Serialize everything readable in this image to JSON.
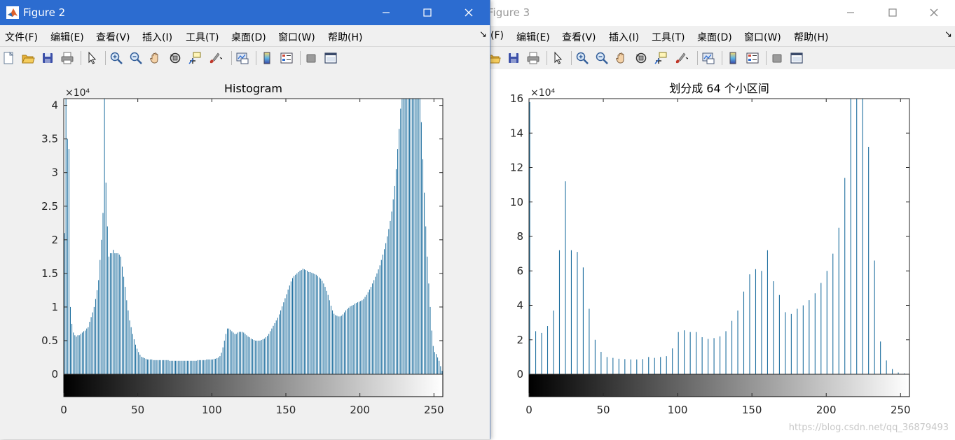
{
  "figure2": {
    "window": {
      "title": "Figure 2",
      "focused": true
    },
    "menu": [
      "文件(F)",
      "编辑(E)",
      "查看(V)",
      "插入(I)",
      "工具(T)",
      "桌面(D)",
      "窗口(W)",
      "帮助(H)"
    ],
    "menu_overflow": "↘",
    "toolbar": [
      "new-figure-icon",
      "open-file-icon",
      "save-icon",
      "print-icon",
      "|",
      "pointer-icon",
      "|",
      "zoom-in-icon",
      "zoom-out-icon",
      "pan-hand-icon",
      "rotate-3d-icon",
      "data-cursor-icon",
      "brush-icon",
      "|",
      "link-plot-icon",
      "|",
      "colorbar-icon",
      "legend-icon",
      "|",
      "hide-plot-tools-icon",
      "show-plot-tools-icon"
    ]
  },
  "figure3": {
    "window": {
      "title": "Figure 3",
      "focused": false
    },
    "menu": [
      "(F)",
      "编辑(E)",
      "查看(V)",
      "插入(I)",
      "工具(T)",
      "桌面(D)",
      "窗口(W)",
      "帮助(H)"
    ],
    "menu_overflow": "↘",
    "toolbar": [
      "open-file-icon",
      "save-icon",
      "print-icon",
      "|",
      "pointer-icon",
      "|",
      "zoom-in-icon",
      "zoom-out-icon",
      "pan-hand-icon",
      "rotate-3d-icon",
      "data-cursor-icon",
      "brush-icon",
      "|",
      "link-plot-icon",
      "|",
      "colorbar-icon",
      "legend-icon",
      "|",
      "hide-plot-tools-icon",
      "show-plot-tools-icon"
    ]
  },
  "watermark": "https://blog.csdn.net/qq_36879493",
  "colors": {
    "bar": "#1f6f9f",
    "titlebar_active": "#2c6cd0"
  },
  "chart_data": [
    {
      "type": "bar",
      "title": "Histogram",
      "exponent_label": "×10⁴",
      "bins": 256,
      "x": "0..255",
      "xlim": [
        0,
        256
      ],
      "ylim": [
        0,
        4.1
      ],
      "xticks": [
        0,
        50,
        100,
        150,
        200,
        250
      ],
      "yticks": [
        0,
        0.5,
        1,
        1.5,
        2,
        2.5,
        3,
        3.5,
        4
      ],
      "ytick_labels": [
        "0",
        "0.5",
        "1",
        "1.5",
        "2",
        "2.5",
        "3",
        "3.5",
        "4"
      ],
      "xtick_labels": [
        "0",
        "50",
        "100",
        "150",
        "200",
        "250"
      ],
      "grayscale_colorbar": true,
      "values": [
        2.1,
        4.1,
        3.5,
        3.35,
        1.0,
        0.75,
        0.62,
        0.58,
        0.56,
        0.58,
        0.58,
        0.6,
        0.62,
        0.64,
        0.65,
        0.68,
        0.7,
        0.78,
        0.85,
        0.92,
        1.0,
        1.12,
        1.25,
        1.4,
        1.7,
        2.0,
        2.4,
        4.1,
        2.85,
        2.2,
        1.75,
        1.8,
        1.8,
        1.85,
        1.8,
        1.8,
        1.8,
        1.78,
        1.75,
        1.6,
        1.45,
        1.3,
        1.1,
        0.95,
        0.8,
        0.7,
        0.6,
        0.52,
        0.44,
        0.38,
        0.33,
        0.29,
        0.26,
        0.25,
        0.24,
        0.23,
        0.22,
        0.22,
        0.22,
        0.22,
        0.21,
        0.21,
        0.21,
        0.21,
        0.21,
        0.21,
        0.21,
        0.21,
        0.21,
        0.21,
        0.21,
        0.2,
        0.2,
        0.2,
        0.2,
        0.2,
        0.2,
        0.2,
        0.2,
        0.2,
        0.2,
        0.2,
        0.2,
        0.2,
        0.2,
        0.2,
        0.2,
        0.2,
        0.2,
        0.2,
        0.21,
        0.21,
        0.21,
        0.21,
        0.21,
        0.21,
        0.22,
        0.22,
        0.22,
        0.22,
        0.22,
        0.23,
        0.23,
        0.24,
        0.25,
        0.27,
        0.32,
        0.4,
        0.5,
        0.6,
        0.68,
        0.68,
        0.66,
        0.64,
        0.62,
        0.6,
        0.6,
        0.62,
        0.63,
        0.63,
        0.63,
        0.62,
        0.6,
        0.58,
        0.56,
        0.55,
        0.53,
        0.52,
        0.51,
        0.5,
        0.5,
        0.5,
        0.5,
        0.51,
        0.52,
        0.53,
        0.55,
        0.57,
        0.6,
        0.64,
        0.68,
        0.72,
        0.76,
        0.8,
        0.84,
        0.89,
        0.95,
        1.01,
        1.07,
        1.13,
        1.19,
        1.26,
        1.32,
        1.38,
        1.43,
        1.46,
        1.48,
        1.5,
        1.52,
        1.54,
        1.55,
        1.57,
        1.56,
        1.55,
        1.54,
        1.52,
        1.52,
        1.51,
        1.5,
        1.49,
        1.48,
        1.46,
        1.44,
        1.42,
        1.39,
        1.35,
        1.3,
        1.24,
        1.18,
        1.1,
        1.02,
        0.95,
        0.9,
        0.88,
        0.87,
        0.86,
        0.86,
        0.87,
        0.89,
        0.92,
        0.95,
        0.97,
        0.99,
        1.01,
        1.02,
        1.03,
        1.05,
        1.06,
        1.07,
        1.08,
        1.09,
        1.1,
        1.12,
        1.15,
        1.18,
        1.22,
        1.26,
        1.3,
        1.35,
        1.4,
        1.45,
        1.5,
        1.56,
        1.62,
        1.7,
        1.78,
        1.86,
        1.95,
        2.05,
        2.16,
        2.28,
        2.42,
        2.6,
        2.8,
        3.05,
        3.35,
        3.65,
        3.95,
        4.1,
        4.1,
        4.1,
        4.1,
        4.1,
        4.1,
        4.1,
        4.1,
        4.1,
        4.1,
        4.1,
        4.1,
        4.1,
        3.75,
        3.2,
        2.7,
        2.2,
        1.75,
        1.35,
        1.0,
        0.65,
        0.42,
        0.33,
        0.3,
        0.25,
        0.2,
        0.12,
        0.05
      ]
    },
    {
      "type": "bar",
      "title": "划分成 64 个小区间",
      "exponent_label": "×10⁴",
      "bins": 64,
      "x": "0,4,8,...,252",
      "xlim": [
        0,
        256
      ],
      "ylim": [
        0,
        16
      ],
      "xticks": [
        0,
        50,
        100,
        150,
        200,
        250
      ],
      "yticks": [
        0,
        2,
        4,
        6,
        8,
        10,
        12,
        14,
        16
      ],
      "ytick_labels": [
        "0",
        "2",
        "4",
        "6",
        "8",
        "10",
        "12",
        "14",
        "16"
      ],
      "xtick_labels": [
        "0",
        "50",
        "100",
        "150",
        "200",
        "250"
      ],
      "grayscale_colorbar": true,
      "values": [
        15.8,
        2.5,
        2.4,
        2.8,
        3.7,
        7.2,
        11.2,
        7.2,
        7.1,
        6.2,
        3.8,
        2.0,
        1.3,
        1.0,
        0.95,
        0.9,
        0.88,
        0.86,
        0.86,
        0.88,
        1.0,
        0.95,
        1.0,
        1.05,
        1.5,
        2.45,
        2.55,
        2.45,
        2.45,
        2.15,
        2.05,
        2.1,
        2.2,
        2.5,
        3.1,
        3.7,
        4.8,
        5.8,
        6.1,
        6.0,
        7.2,
        5.4,
        4.6,
        3.6,
        3.5,
        3.8,
        4.0,
        4.3,
        4.7,
        5.3,
        6.0,
        7.0,
        8.5,
        11.4,
        16.0,
        16.0,
        16.0,
        13.2,
        6.6,
        1.9,
        0.8,
        0.3,
        0.1,
        0.05
      ]
    }
  ]
}
